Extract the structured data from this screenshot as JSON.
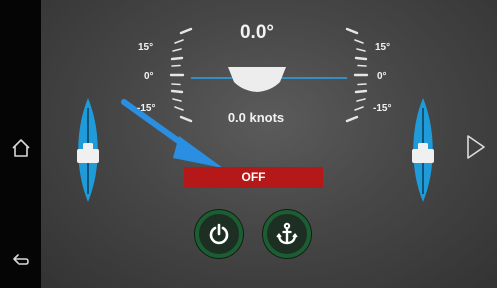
{
  "navigation": {
    "home_icon": "house-outline-icon",
    "back_icon": "back-arrow-icon"
  },
  "instrument": {
    "heel_angle": "0.0°",
    "speed": "0.0 knots",
    "left_scale": {
      "top": "15°",
      "middle": "0°",
      "bottom": "-15°"
    },
    "right_scale": {
      "top": "15°",
      "middle": "0°",
      "bottom": "-15°"
    }
  },
  "status": {
    "label": "OFF",
    "color": "#b41818"
  },
  "controls": {
    "power_icon": "power-icon",
    "anchor_icon": "anchor-icon",
    "next_icon": "triangle-right-icon",
    "button_ring_color": "#1d5d33"
  },
  "tabs": {
    "color": "#1f9bd9"
  },
  "annotation": {
    "arrow_color": "#2a8fe0"
  }
}
